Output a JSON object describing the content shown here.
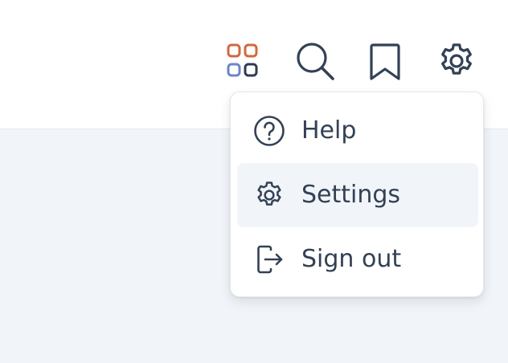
{
  "header": {
    "icons": [
      "apps-icon",
      "search-icon",
      "bookmark-icon",
      "settings-icon"
    ]
  },
  "menu": {
    "items": [
      {
        "label": "Help",
        "icon": "help-circle-icon"
      },
      {
        "label": "Settings",
        "icon": "gear-icon",
        "active": true
      },
      {
        "label": "Sign out",
        "icon": "sign-out-icon"
      }
    ]
  },
  "colors": {
    "icon_stroke": "#334155",
    "apps_orange": "#d2693f",
    "apps_blue": "#6b86c7",
    "apps_dark": "#2f3b52",
    "active_bg": "#f1f5f9"
  }
}
